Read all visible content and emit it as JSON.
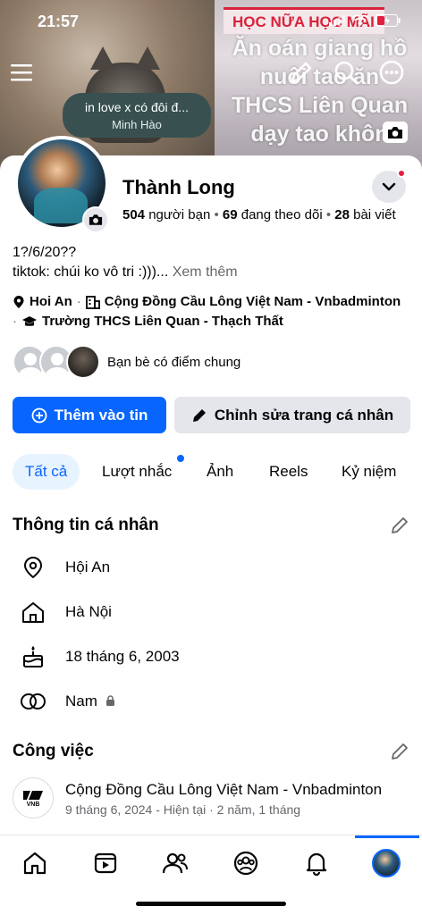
{
  "status_bar": {
    "time": "21:57"
  },
  "cover": {
    "banner_text": "HỌC NỮA HỌC MÃI",
    "overlay_lines": [
      "Ăn oán giang hồ",
      "nuôi tao ăn",
      "THCS Liên Quan",
      "dạy tao khôn"
    ]
  },
  "note": {
    "title": "in love x có đôi đ...",
    "artist": "Minh Hào"
  },
  "profile": {
    "name": "Thành Long",
    "friends_count": "504",
    "friends_label": "người bạn",
    "following_count": "69",
    "following_label": "đang theo dõi",
    "posts_count": "28",
    "posts_label": "bài viết",
    "bio_line1": "1?/6/20??",
    "bio_line2": "tiktok: chúi ko vô tri :)))...",
    "see_more": "Xem thêm",
    "location": "Hoi An",
    "work_page": "Cộng Đồng Cầu Lông Việt Nam - Vnbadminton",
    "school": "Trường THCS Liên Quan - Thạch Thất",
    "mutual_label": "Bạn bè có điểm chung"
  },
  "actions": {
    "add_story": "Thêm vào tin",
    "edit_profile": "Chỉnh sửa trang cá nhân"
  },
  "tabs": [
    "Tất cả",
    "Lượt nhắc",
    "Ảnh",
    "Reels",
    "Kỷ niệm"
  ],
  "personal_info": {
    "title": "Thông tin cá nhân",
    "current_city": "Hội An",
    "hometown": "Hà Nội",
    "birthday": "18 tháng 6, 2003",
    "gender": "Nam"
  },
  "work": {
    "title": "Công việc",
    "company": "Cộng Đồng Cầu Lông Việt Nam - Vnbadminton",
    "detail": "9 tháng 6, 2024 - Hiện tại · 2 năm, 1 tháng",
    "logo_text": "VNB"
  },
  "colors": {
    "accent": "#0866ff",
    "tab_bg": "#e7f3ff",
    "button_gray": "#e4e6eb",
    "secondary_text": "#65676b"
  }
}
